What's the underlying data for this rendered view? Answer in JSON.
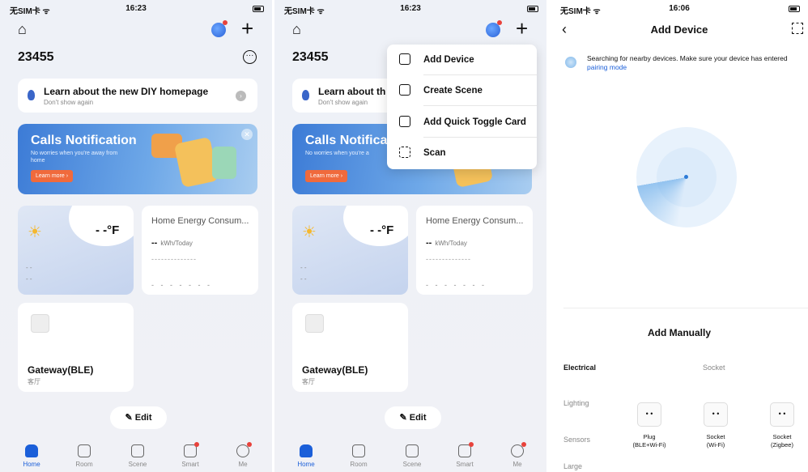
{
  "status": {
    "carrier": "无SIM卡 ᯤ",
    "time_1": "16:23",
    "time_2": "16:23",
    "time_3": "16:06"
  },
  "home": {
    "name": "23455",
    "learn_title": "Learn about the new DIY homepage",
    "learn_sub": "Don't show again",
    "banner_title": "Calls Notification",
    "banner_sub": "No worries when you're away from home",
    "banner_cta": "Learn more ›",
    "weather_temp": "- -°F",
    "weather_d1": "- -",
    "weather_d2": "- -",
    "energy_title": "Home Energy Consum...",
    "energy_value": "--",
    "energy_unit": "kWh/Today",
    "energy_dash1": "--------------",
    "energy_dash2": "- - - - - - -",
    "gateway_name": "Gateway(BLE)",
    "gateway_room": "客厅",
    "edit_label": "Edit"
  },
  "home2": {
    "learn_title": "Learn about th",
    "banner_title": "Calls Notifica",
    "banner_sub": "No worries when you're a"
  },
  "tabs": [
    "Home",
    "Room",
    "Scene",
    "Smart",
    "Me"
  ],
  "menu": {
    "items": [
      "Add Device",
      "Create Scene",
      "Add Quick Toggle Card",
      "Scan"
    ]
  },
  "add_device": {
    "title": "Add Device",
    "search_text": "Searching for nearby devices. Make sure your device has entered",
    "search_link": "pairing mode",
    "add_manually": "Add Manually",
    "categories": [
      "Electrical",
      "Lighting",
      "Sensors",
      "Large"
    ],
    "section_header": "Socket",
    "devices": [
      {
        "name": "Plug",
        "sub": "(BLE+Wi-Fi)"
      },
      {
        "name": "Socket",
        "sub": "(Wi-Fi)"
      },
      {
        "name": "Socket",
        "sub": "(Zigbee)"
      }
    ]
  },
  "colors": {
    "accent": "#1b5fd9",
    "banner": "#3c7bd6",
    "cta": "#f06a3c",
    "badge": "#e8423b"
  }
}
